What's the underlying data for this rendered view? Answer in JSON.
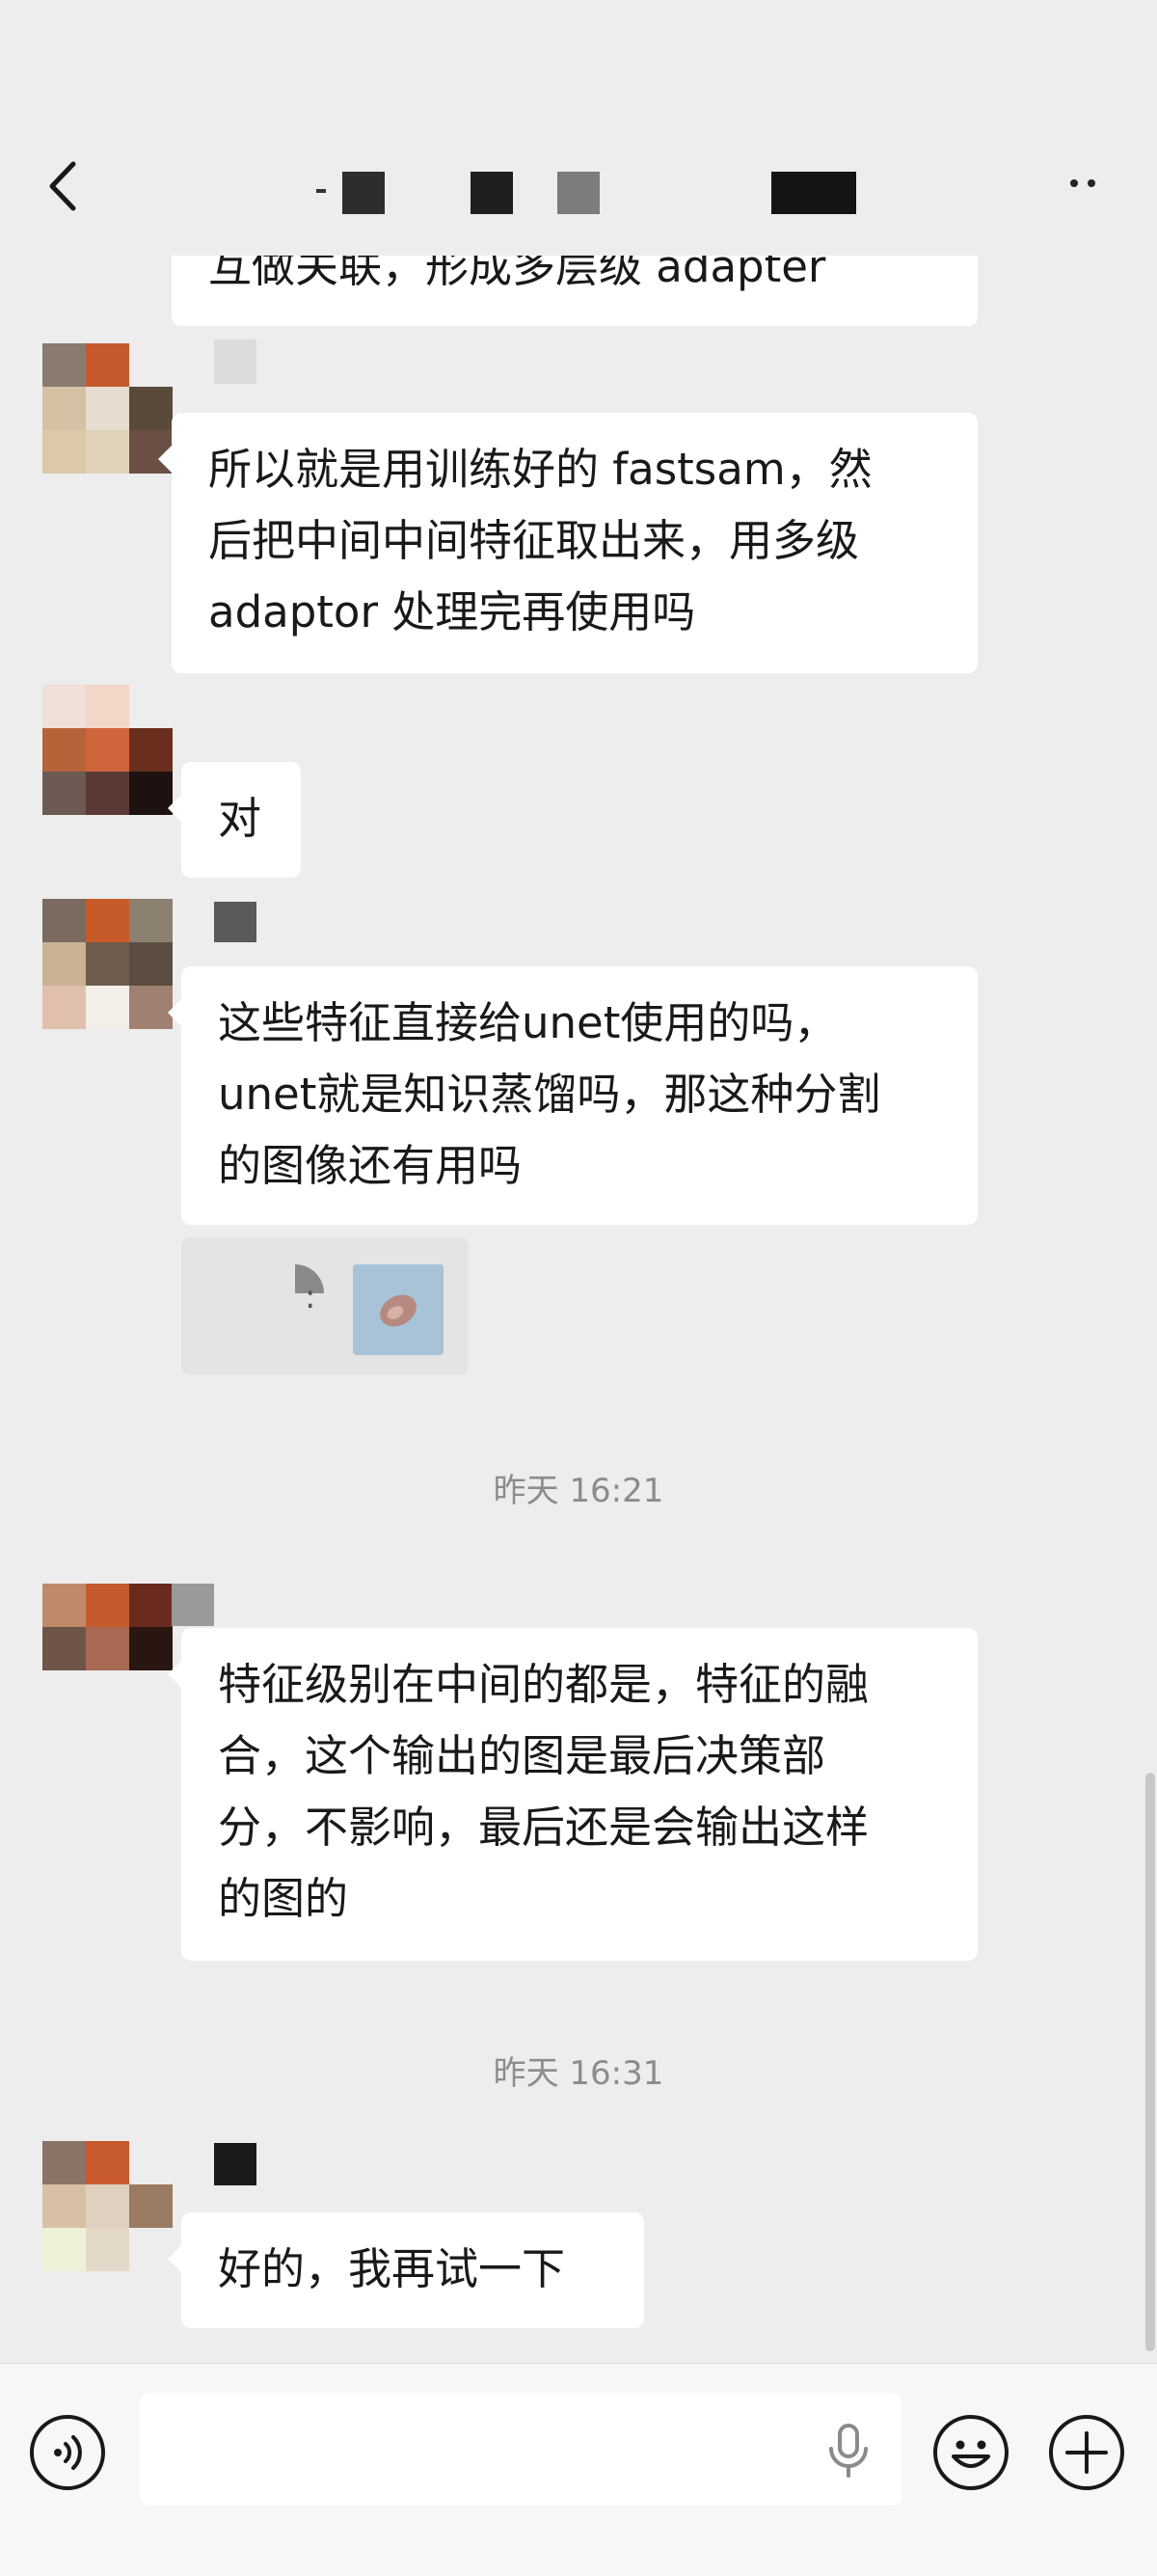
{
  "header": {
    "title": ""
  },
  "colors": {
    "background": "#ededed",
    "bubble": "#ffffff",
    "timestamp": "#8c8c8c",
    "input_bar": "#f7f7f7"
  },
  "messages": [
    {
      "lines": [
        "互做关联，形成多层级 adapter"
      ]
    },
    {
      "lines": [
        "所以就是用训练好的 fastsam，然",
        "后把中间中间特征取出来，用多级",
        "adaptor 处理完再使用吗"
      ]
    },
    {
      "lines": [
        "对"
      ]
    },
    {
      "lines": [
        "这些特征直接给unet使用的吗，",
        "unet就是知识蒸馏吗，那这种分割",
        "的图像还有用吗"
      ]
    },
    {
      "quote_sep": ":"
    },
    {
      "lines": [
        "特征级别在中间的都是，特征的融",
        "合，这个输出的图是最后决策部",
        "分，不影响，最后还是会输出这样",
        "的图的"
      ]
    },
    {
      "lines": [
        "好的，我再试一下"
      ]
    }
  ],
  "timestamps": [
    "昨天 16:21",
    "昨天 16:31"
  ],
  "input": {
    "value": "",
    "placeholder": ""
  },
  "icons": [
    "back-arrow-icon",
    "more-dots-icon",
    "voice-icon",
    "microphone-icon",
    "emoji-icon",
    "plus-icon"
  ]
}
